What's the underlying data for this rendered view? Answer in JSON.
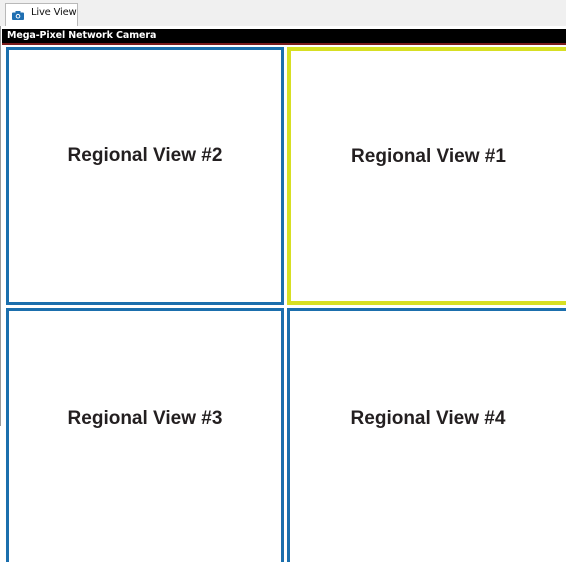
{
  "tab": {
    "label": "Live View",
    "icon": "camera-icon"
  },
  "camera_title": "Mega-Pixel Network Camera",
  "views": {
    "v1": {
      "label": "Regional View #1",
      "border_color": "#d7df23"
    },
    "v2": {
      "label": "Regional View #2",
      "border_color": "#1b6fad"
    },
    "v3": {
      "label": "Regional View #3",
      "border_color": "#1b6fad"
    },
    "v4": {
      "label": "Regional View #4",
      "border_color": "#1b6fad"
    }
  },
  "colors": {
    "selected": "#d7df23",
    "normal": "#1b6fad",
    "title_bar": "#000000"
  }
}
